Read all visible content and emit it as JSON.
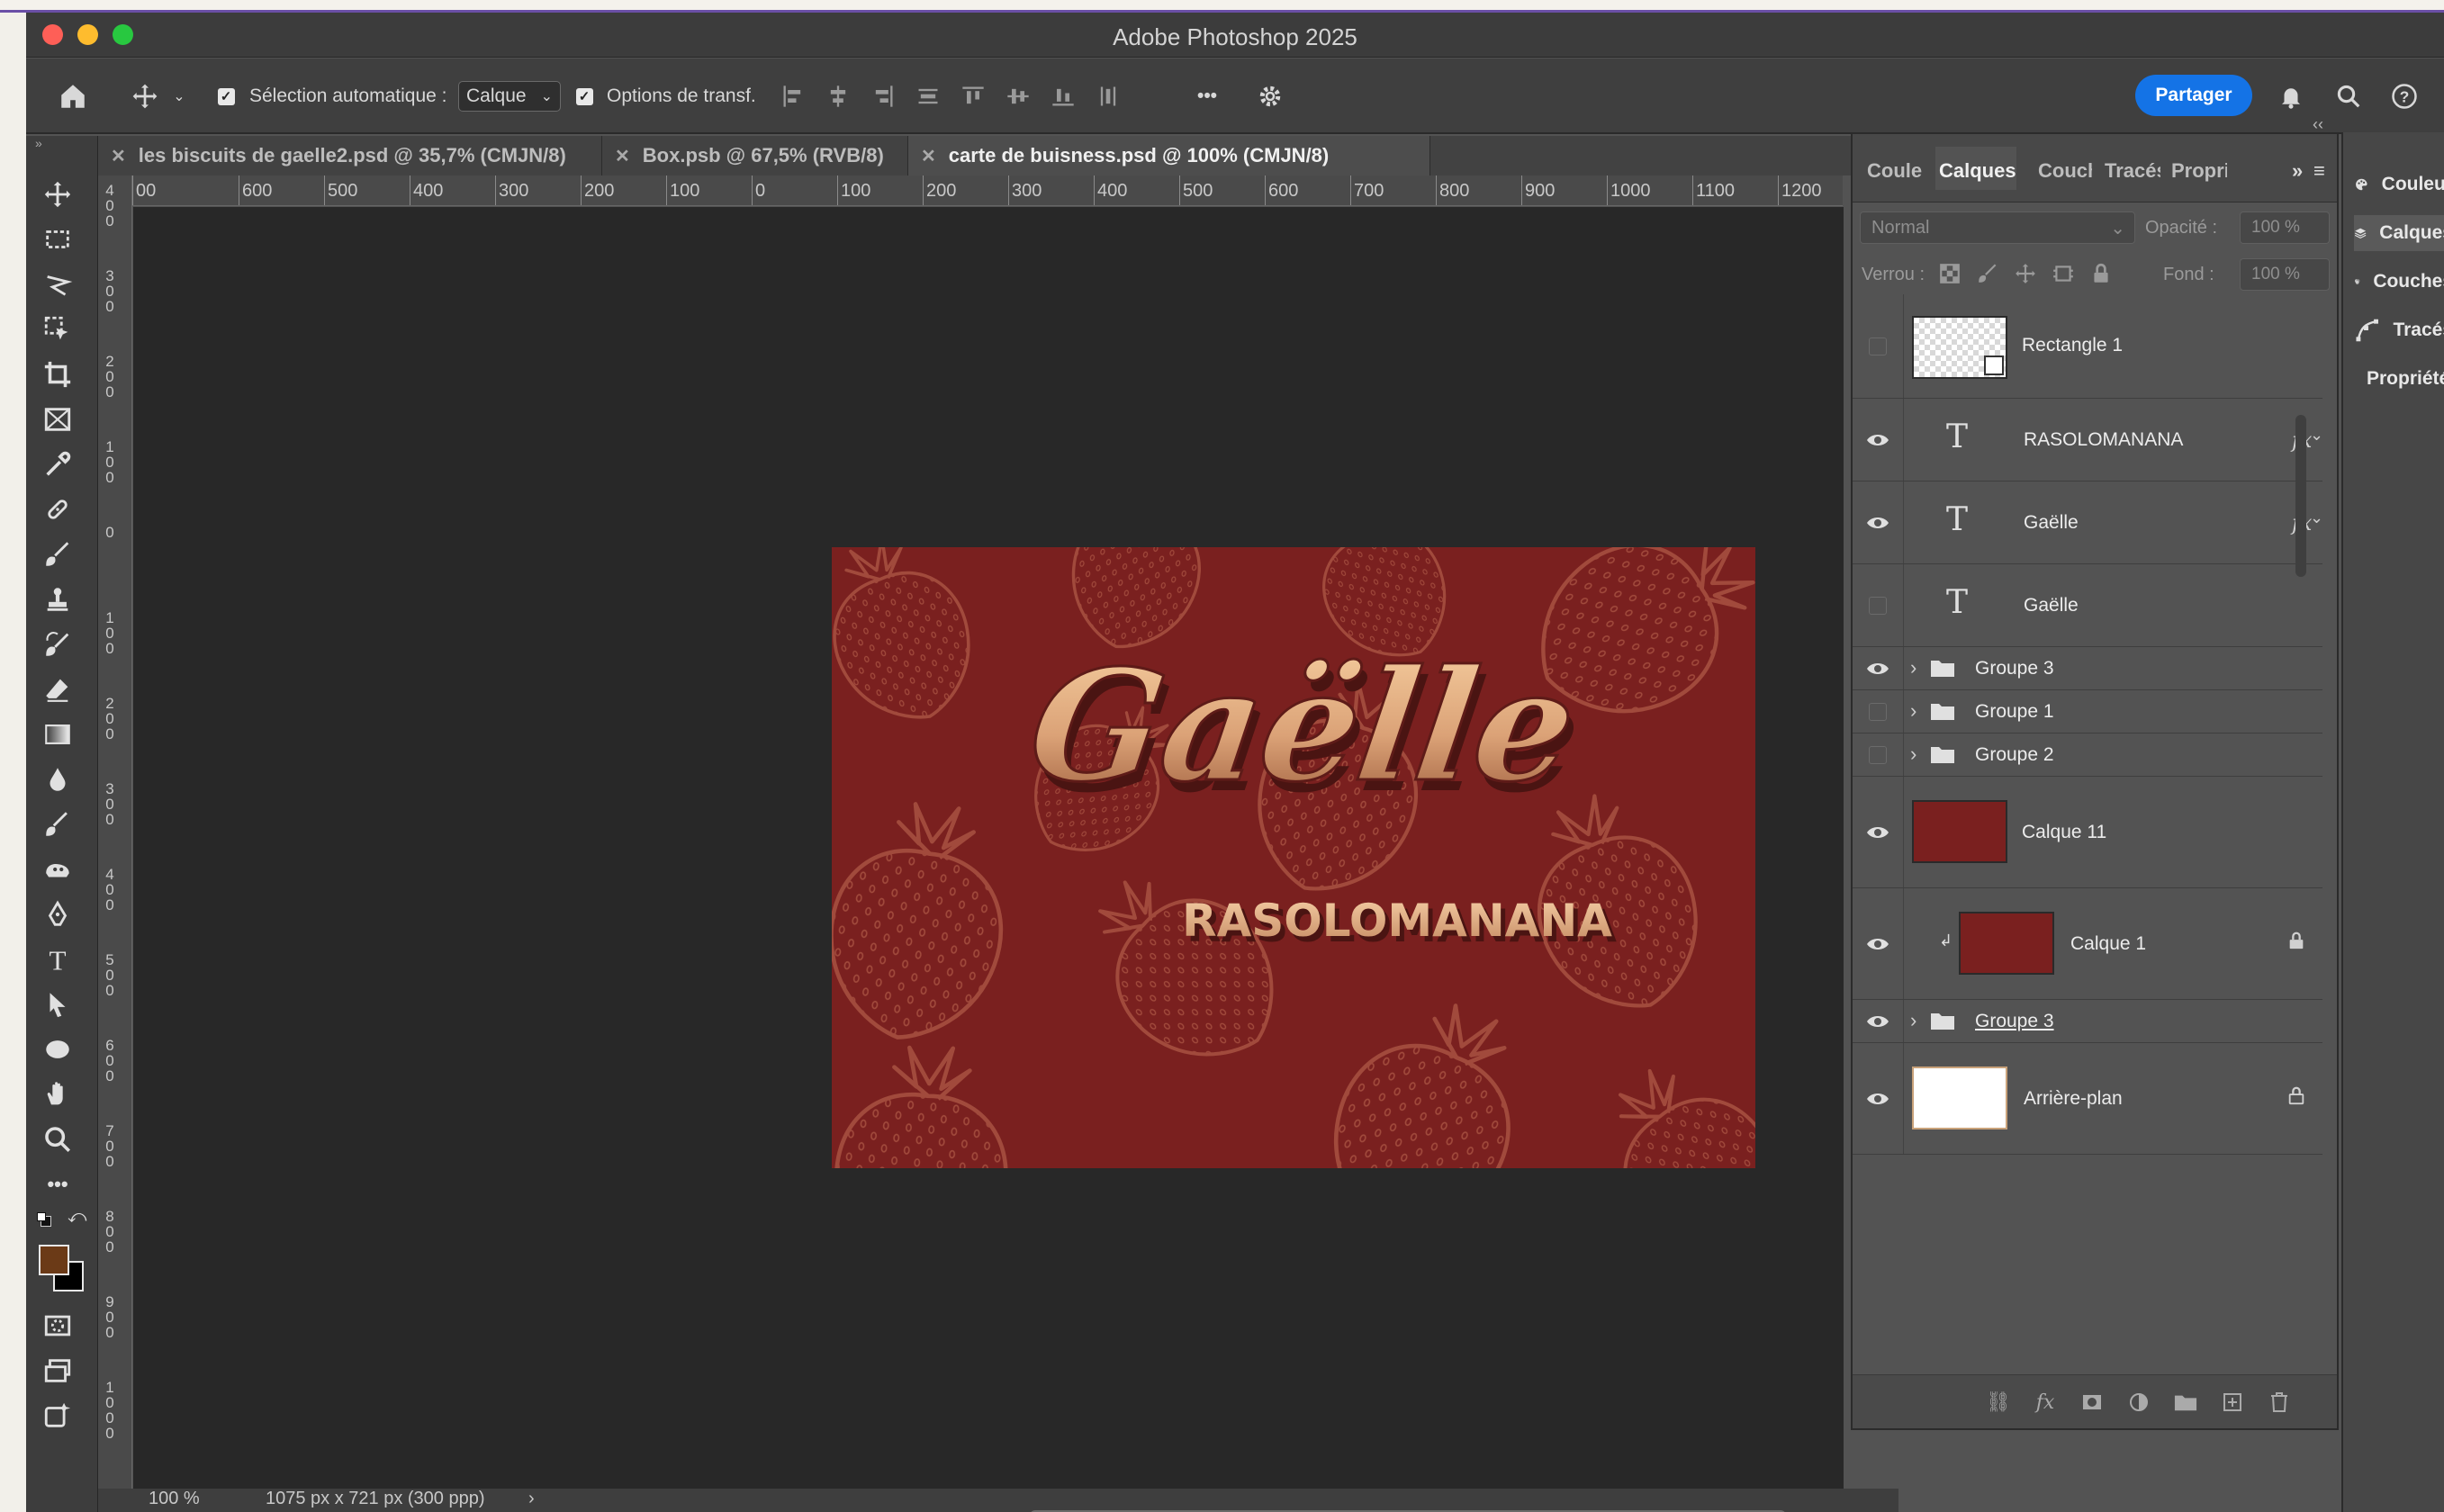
{
  "app": {
    "title": "Adobe Photoshop 2025"
  },
  "options_bar": {
    "auto_select_label": "Sélection automatique :",
    "auto_select_value": "Calque",
    "transform_label": "Options de transf.",
    "more_label": "•••",
    "share_label": "Partager"
  },
  "tabs": [
    {
      "label": "les biscuits de gaelle2.psd @ 35,7% (CMJN/8)"
    },
    {
      "label": "Box.psb @ 67,5% (RVB/8)"
    },
    {
      "label": "carte de buisness.psd @ 100% (CMJN/8)"
    }
  ],
  "ruler": {
    "top": [
      "00",
      "600",
      "500",
      "400",
      "300",
      "200",
      "100",
      "0",
      "100",
      "200",
      "300",
      "400",
      "500",
      "600",
      "700",
      "800",
      "900",
      "1000",
      "1100",
      "1200"
    ],
    "left": [
      "400",
      "300",
      "200",
      "100",
      "0",
      "100",
      "200",
      "300",
      "400",
      "500",
      "600",
      "700",
      "800",
      "900",
      "1000"
    ]
  },
  "document": {
    "name_script": "Gaëlle",
    "surname": "RASOLOMANANA",
    "background": "#7a201f"
  },
  "panel": {
    "tabs": [
      "Couleur",
      "Calques",
      "Couches",
      "Tracés",
      "Propriétés"
    ],
    "blend_mode": "Normal",
    "opacity_label": "Opacité :",
    "opacity_value": "100 %",
    "lock_label": "Verrou :",
    "fill_label": "Fond :",
    "fill_value": "100 %"
  },
  "layers": [
    {
      "name": "Rectangle 1",
      "visible": false
    },
    {
      "name": "RASOLOMANANA",
      "visible": true,
      "fx": "fx"
    },
    {
      "name": "Gaëlle",
      "visible": true,
      "fx": "fx"
    },
    {
      "name": "Gaëlle",
      "visible": false
    },
    {
      "name": "Groupe 3",
      "visible": true
    },
    {
      "name": "Groupe 1",
      "visible": false
    },
    {
      "name": "Groupe 2",
      "visible": false
    },
    {
      "name": "Calque 11",
      "visible": true
    },
    {
      "name": "Calque 1",
      "visible": true
    },
    {
      "name": "Groupe 3",
      "visible": true
    },
    {
      "name": "Arrière-plan",
      "visible": true
    }
  ],
  "side_panel": [
    "Couleur",
    "Calques",
    "Couches",
    "Tracés",
    "Propriétés"
  ],
  "status": {
    "zoom": "100 %",
    "dimensions": "1075 px x 721 px (300 ppp)",
    "arrow": "›"
  },
  "colors": {
    "accent": "#1473e6",
    "foreground": "#6b3a17",
    "background": "#000000"
  }
}
